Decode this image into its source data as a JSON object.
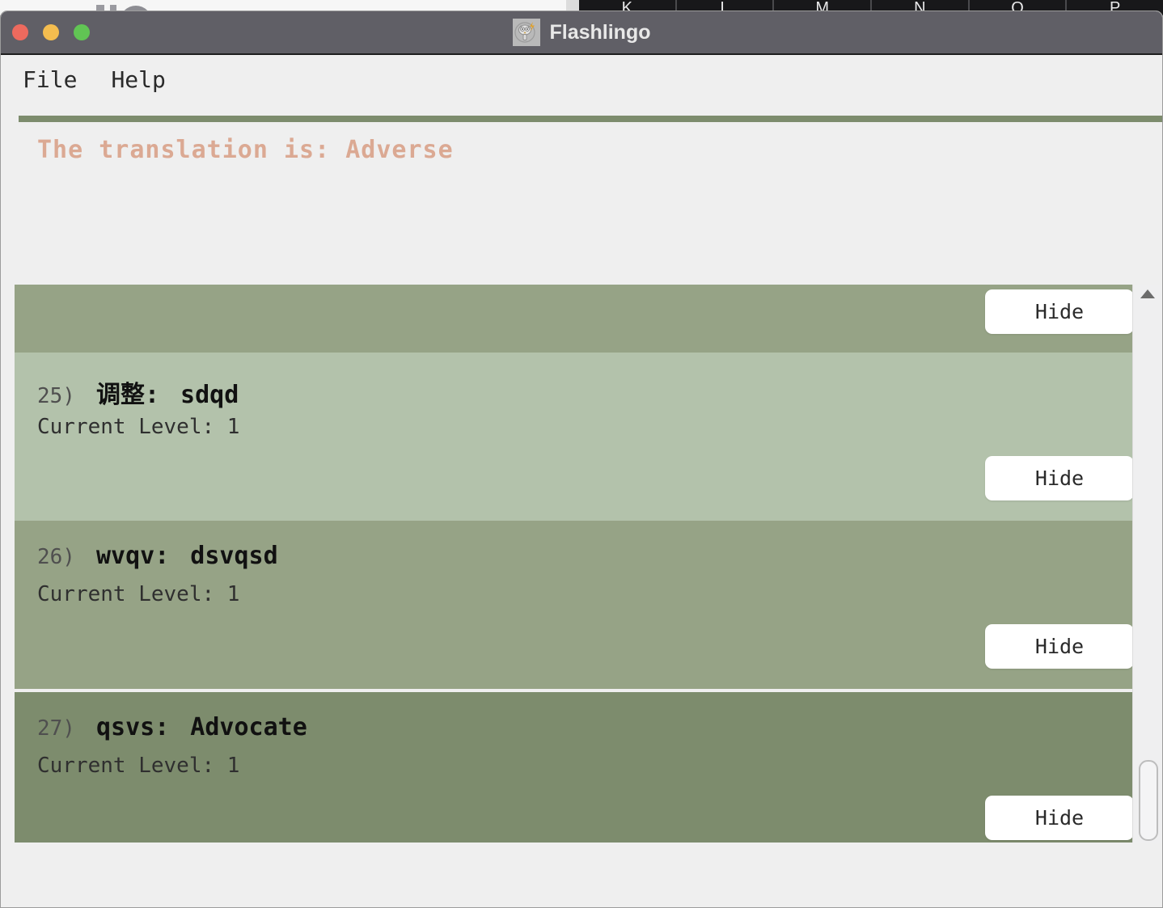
{
  "background": {
    "spreadsheet_columns": [
      "K",
      "L",
      "M",
      "N",
      "O",
      "P"
    ]
  },
  "window": {
    "title": "Flashlingo",
    "app_icon": "owl-lightning-icon",
    "traffic_lights": {
      "close": "close-button",
      "minimize": "minimize-button",
      "maximize": "maximize-button"
    }
  },
  "menubar": {
    "items": [
      {
        "label": "File"
      },
      {
        "label": "Help"
      }
    ]
  },
  "translation": {
    "text": "The translation is: Adverse",
    "color": "#dba993"
  },
  "colors": {
    "accent_bar": "#7d8c6d",
    "window_bg": "#efefef",
    "titlebar": "#605f66",
    "row_shades": [
      "#96a386",
      "#b3c2ab",
      "#96a386",
      "#7d8c6d"
    ]
  },
  "list": {
    "hide_label": "Hide",
    "level_prefix": "Current Level:",
    "items": [
      {
        "index": "",
        "word": "",
        "translation": "",
        "level": "",
        "hide_label": "Hide",
        "partial": true
      },
      {
        "index": "25)",
        "word": "调整:",
        "translation": "sdqd",
        "level_line": "Current Level: 1",
        "hide_label": "Hide"
      },
      {
        "index": "26)",
        "word": "wvqv:",
        "translation": "dsvqsd",
        "level_line": "Current Level: 1",
        "hide_label": "Hide"
      },
      {
        "index": "27)",
        "word": "qsvs:",
        "translation": "Advocate",
        "level_line": "Current Level: 1",
        "hide_label": "Hide"
      }
    ]
  },
  "scrollbar": {
    "up_arrow": "scroll-up-arrow"
  }
}
